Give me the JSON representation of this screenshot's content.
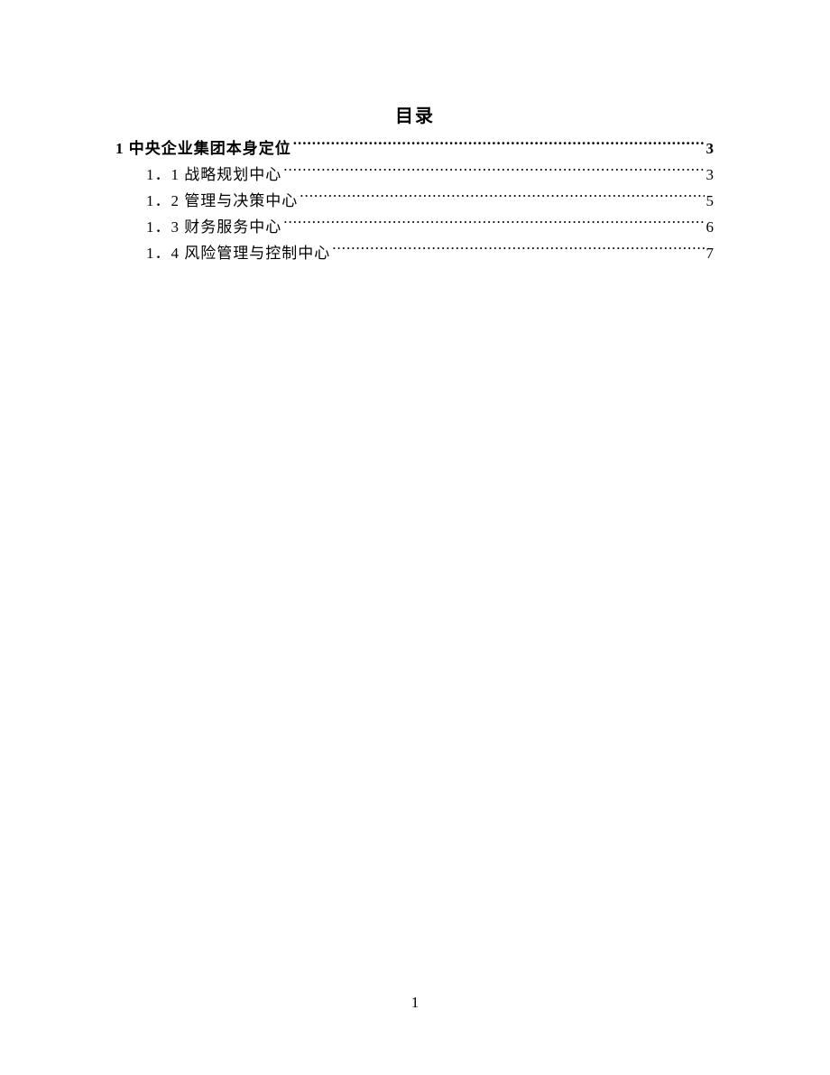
{
  "title": "目录",
  "entries": [
    {
      "level": 1,
      "label": "1 中央企业集团本身定位",
      "page": "3"
    },
    {
      "level": 2,
      "label": "1．1 战略规划中心",
      "page": "3"
    },
    {
      "level": 2,
      "label": "1．2 管理与决策中心",
      "page": "5"
    },
    {
      "level": 2,
      "label": "1．3 财务服务中心",
      "page": "6"
    },
    {
      "level": 2,
      "label": "1．4 风险管理与控制中心",
      "page": "7"
    }
  ],
  "page_number": "1"
}
